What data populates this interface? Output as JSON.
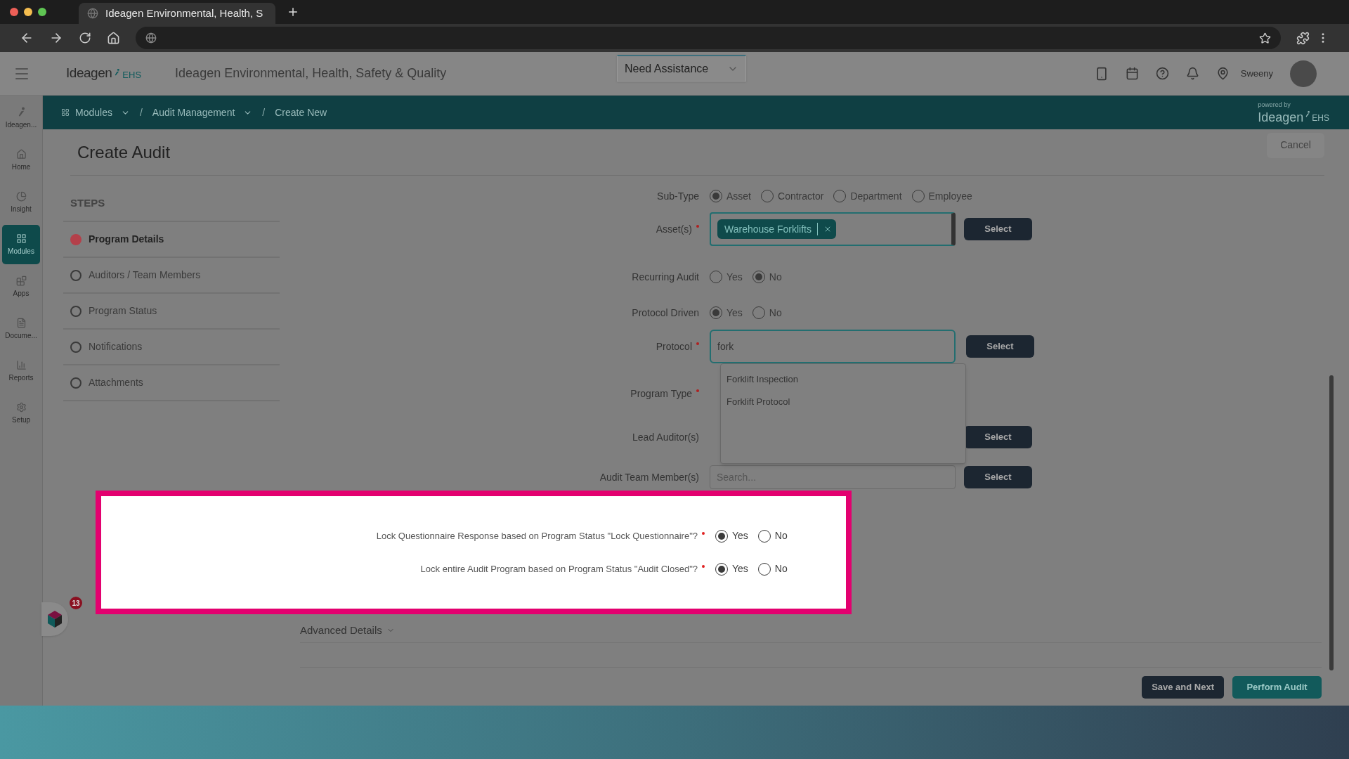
{
  "browser": {
    "tab_title": "Ideagen Environmental, Health, S"
  },
  "header": {
    "logo": "Ideagen",
    "logo_suffix": "EHS",
    "title": "Ideagen Environmental, Health, Safety & Quality",
    "assistance": "Need Assistance",
    "user": "Sweeny"
  },
  "sidebar": {
    "items": [
      {
        "kind": "logo",
        "label": "Ideagen...",
        "selected": false
      },
      {
        "kind": "home",
        "label": "Home",
        "selected": false
      },
      {
        "kind": "insight",
        "label": "Insight",
        "selected": false
      },
      {
        "kind": "modules",
        "label": "Modules",
        "selected": true
      },
      {
        "kind": "apps",
        "label": "Apps",
        "selected": false
      },
      {
        "kind": "documents",
        "label": "Docume...",
        "selected": false
      },
      {
        "kind": "reports",
        "label": "Reports",
        "selected": false
      },
      {
        "kind": "setup",
        "label": "Setup",
        "selected": false
      }
    ]
  },
  "breadcrumbs": [
    {
      "label": "Modules",
      "dropdown": true
    },
    {
      "separator": "/",
      "label": "Audit Management",
      "dropdown": true
    },
    {
      "separator": "/",
      "label": "Create New",
      "dropdown": false
    }
  ],
  "powered_by": {
    "caption": "powered by",
    "logo": "Ideagen",
    "logo_suffix": "EHS"
  },
  "page": {
    "title": "Create Audit",
    "cancel": "Cancel"
  },
  "steps": {
    "heading": "STEPS",
    "items": [
      {
        "label": "Program Details",
        "selected": true
      },
      {
        "label": "Auditors / Team Members",
        "selected": false
      },
      {
        "label": "Program Status",
        "selected": false
      },
      {
        "label": "Notifications",
        "selected": false
      },
      {
        "label": "Attachments",
        "selected": false
      }
    ]
  },
  "form": {
    "sub_type": {
      "label": "Sub-Type",
      "options": [
        {
          "label": "Asset",
          "selected": true
        },
        {
          "label": "Contractor",
          "selected": false
        },
        {
          "label": "Department",
          "selected": false
        },
        {
          "label": "Employee",
          "selected": false
        }
      ]
    },
    "assets": {
      "label": "Asset(s)",
      "required": true,
      "chips": [
        {
          "label": "Warehouse Forklifts"
        }
      ],
      "button": "Select"
    },
    "recurring": {
      "label": "Recurring Audit",
      "options": [
        {
          "label": "Yes",
          "selected": false
        },
        {
          "label": "No",
          "selected": true
        }
      ]
    },
    "protocol_driven": {
      "label": "Protocol Driven",
      "options": [
        {
          "label": "Yes",
          "selected": true
        },
        {
          "label": "No",
          "selected": false
        }
      ]
    },
    "protocol": {
      "label": "Protocol",
      "required": true,
      "value": "fork",
      "button": "Select",
      "suggestions": [
        "Forklift Inspection",
        "Forklift Protocol"
      ]
    },
    "program_type": {
      "label": "Program Type",
      "required": true
    },
    "lead_auditors": {
      "label": "Lead Auditor(s)",
      "button": "Select"
    },
    "team_members": {
      "label": "Audit Team Member(s)",
      "placeholder": "Search...",
      "button": "Select"
    }
  },
  "highlight": {
    "questions": [
      {
        "label": "Lock Questionnaire Response based on Program Status \"Lock Questionnaire\"?",
        "required": true,
        "options": [
          {
            "label": "Yes",
            "selected": true
          },
          {
            "label": "No",
            "selected": false
          }
        ]
      },
      {
        "label": "Lock entire Audit Program based on Program Status \"Audit Closed\"?",
        "required": true,
        "options": [
          {
            "label": "Yes",
            "selected": true
          },
          {
            "label": "No",
            "selected": false
          }
        ]
      }
    ]
  },
  "advanced_details": "Advanced Details",
  "footer": {
    "buttons": [
      {
        "kind": "secondary",
        "label": "Save and Next"
      },
      {
        "kind": "primary",
        "label": "Perform Audit"
      }
    ]
  },
  "chat_badge": "13"
}
